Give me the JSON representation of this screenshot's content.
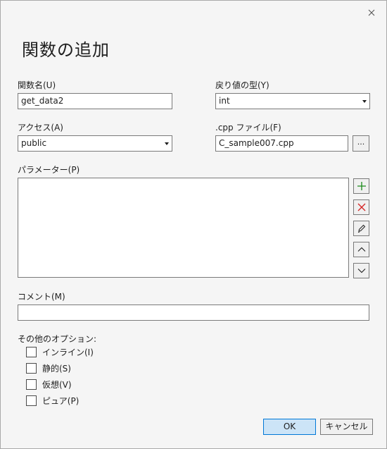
{
  "dialog": {
    "title": "関数の追加",
    "close_icon": "close-icon"
  },
  "function_name": {
    "label": "関数名(U)",
    "value": "get_data2"
  },
  "return_type": {
    "label": "戻り値の型(Y)",
    "value": "int"
  },
  "access": {
    "label": "アクセス(A)",
    "value": "public"
  },
  "cpp_file": {
    "label": ".cpp ファイル(F)",
    "value": "C_sample007.cpp",
    "browse_label": "..."
  },
  "parameters": {
    "label": "パラメーター(P)",
    "items": [],
    "buttons": {
      "add_icon": "plus-icon",
      "delete_icon": "delete-icon",
      "edit_icon": "pencil-icon",
      "up_icon": "chevron-up-icon",
      "down_icon": "chevron-down-icon"
    }
  },
  "comment": {
    "label": "コメント(M)",
    "value": ""
  },
  "other_options": {
    "label": "その他のオプション:",
    "items": [
      {
        "label": "インライン(I)",
        "checked": false
      },
      {
        "label": "静的(S)",
        "checked": false
      },
      {
        "label": "仮想(V)",
        "checked": false
      },
      {
        "label": "ピュア(P)",
        "checked": false
      }
    ]
  },
  "footer": {
    "ok_label": "OK",
    "cancel_label": "キャンセル"
  },
  "colors": {
    "plus": "#1a8a1a",
    "delete": "#d42424",
    "primary_button_bg": "#cce4f7",
    "primary_button_border": "#0078d7"
  }
}
